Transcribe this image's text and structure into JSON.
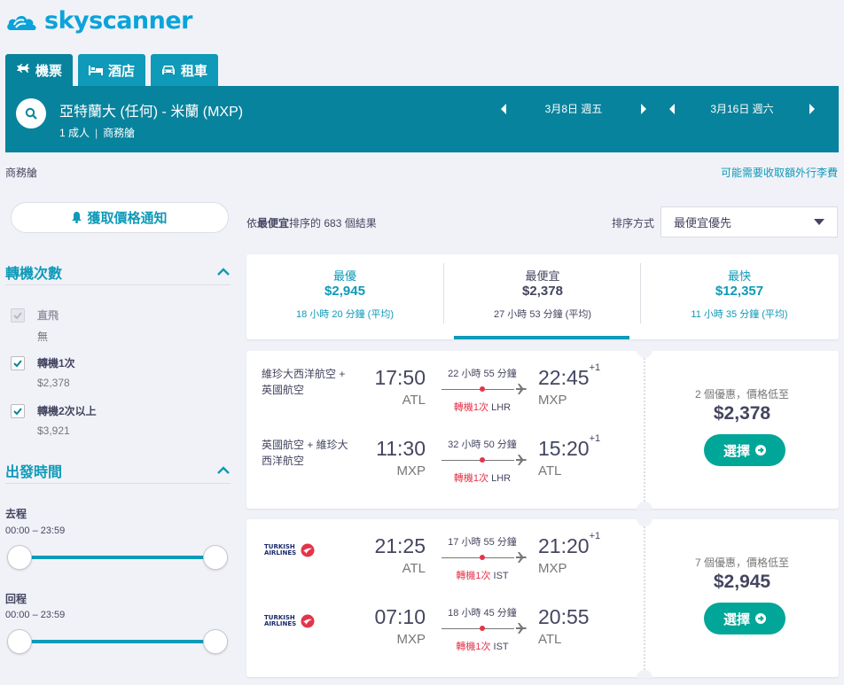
{
  "brand": {
    "name": "skyscanner"
  },
  "tabs": [
    {
      "label": "機票",
      "icon": "plane-icon"
    },
    {
      "label": "酒店",
      "icon": "bed-icon"
    },
    {
      "label": "租車",
      "icon": "car-icon"
    }
  ],
  "search": {
    "route": "亞特蘭大 (任何) - 米蘭 (MXP)",
    "passengers": "1 成人",
    "cabin": "商務艙",
    "depart_date": "3月8日 週五",
    "return_date": "3月16日 週六"
  },
  "cabin_note": "商務艙",
  "fee_link": "可能需要收取額外行李費",
  "price_alert": "獲取價格通知",
  "filters": {
    "stops": {
      "title": "轉機次數",
      "options": [
        {
          "label": "直飛",
          "sub": "無",
          "checked": false,
          "disabled": true
        },
        {
          "label": "轉機1次",
          "sub": "$2,378",
          "checked": true,
          "disabled": false
        },
        {
          "label": "轉機2次以上",
          "sub": "$3,921",
          "checked": true,
          "disabled": false
        }
      ]
    },
    "departure_times": {
      "title": "出發時間",
      "outbound": {
        "label": "去程",
        "range": "00:00 – 23:59"
      },
      "return": {
        "label": "回程",
        "range": "00:00 – 23:59"
      }
    }
  },
  "results": {
    "prefix": "依",
    "sort_word": "最便宜",
    "middle": "排序的 ",
    "count": "683",
    "suffix": " 個結果"
  },
  "sort": {
    "label": "排序方式",
    "selected": "最便宜優先"
  },
  "sort_tabs": [
    {
      "label": "最優",
      "price": "$2,945",
      "duration": "18 小時 20 分鐘 (平均)",
      "active": false
    },
    {
      "label": "最便宜",
      "price": "$2,378",
      "duration": "27 小時 53 分鐘 (平均)",
      "active": true
    },
    {
      "label": "最快",
      "price": "$12,357",
      "duration": "11 小時 35 分鐘 (平均)",
      "active": false
    }
  ],
  "cards": [
    {
      "legs": [
        {
          "airline": "維珍大西洋航空 + 英國航空",
          "logo": false,
          "dep_time": "17:50",
          "dep_airport": "ATL",
          "duration": "22 小時 55 分鐘",
          "stops_text": "轉機1次",
          "via": "LHR",
          "arr_time": "22:45",
          "plus_day": "+1",
          "arr_airport": "MXP"
        },
        {
          "airline": "英國航空 + 維珍大西洋航空",
          "logo": false,
          "dep_time": "11:30",
          "dep_airport": "MXP",
          "duration": "32 小時 50 分鐘",
          "stops_text": "轉機1次",
          "via": "LHR",
          "arr_time": "15:20",
          "plus_day": "+1",
          "arr_airport": "ATL"
        }
      ],
      "deals": "2 個優惠，價格低至",
      "price": "$2,378",
      "select": "選擇"
    },
    {
      "legs": [
        {
          "airline": "TURKISH AIRLINES",
          "logo": true,
          "dep_time": "21:25",
          "dep_airport": "ATL",
          "duration": "17 小時 55 分鐘",
          "stops_text": "轉機1次",
          "via": "IST",
          "arr_time": "21:20",
          "plus_day": "+1",
          "arr_airport": "MXP"
        },
        {
          "airline": "TURKISH AIRLINES",
          "logo": true,
          "dep_time": "07:10",
          "dep_airport": "MXP",
          "duration": "18 小時 45 分鐘",
          "stops_text": "轉機1次",
          "via": "IST",
          "arr_time": "20:55",
          "plus_day": "",
          "arr_airport": "ATL"
        }
      ],
      "deals": "7 個優惠，價格低至",
      "price": "$2,945",
      "select": "選擇"
    }
  ],
  "colors": {
    "brand": "#0ba3d9",
    "header": "#08839d",
    "accent": "#0e9ab8",
    "select": "#00a698",
    "stop_red": "#e4344a"
  }
}
